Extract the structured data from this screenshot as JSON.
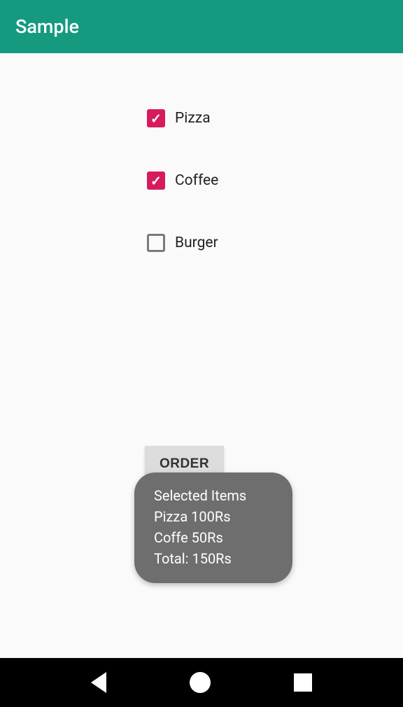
{
  "appBar": {
    "title": "Sample"
  },
  "items": [
    {
      "label": "Pizza",
      "checked": true
    },
    {
      "label": "Coffee",
      "checked": true
    },
    {
      "label": "Burger",
      "checked": false
    }
  ],
  "orderButton": {
    "label": "ORDER"
  },
  "toast": {
    "line1": "Selected Items",
    "line2": "Pizza 100Rs",
    "line3": "Coffe 50Rs",
    "line4": "Total: 150Rs"
  }
}
